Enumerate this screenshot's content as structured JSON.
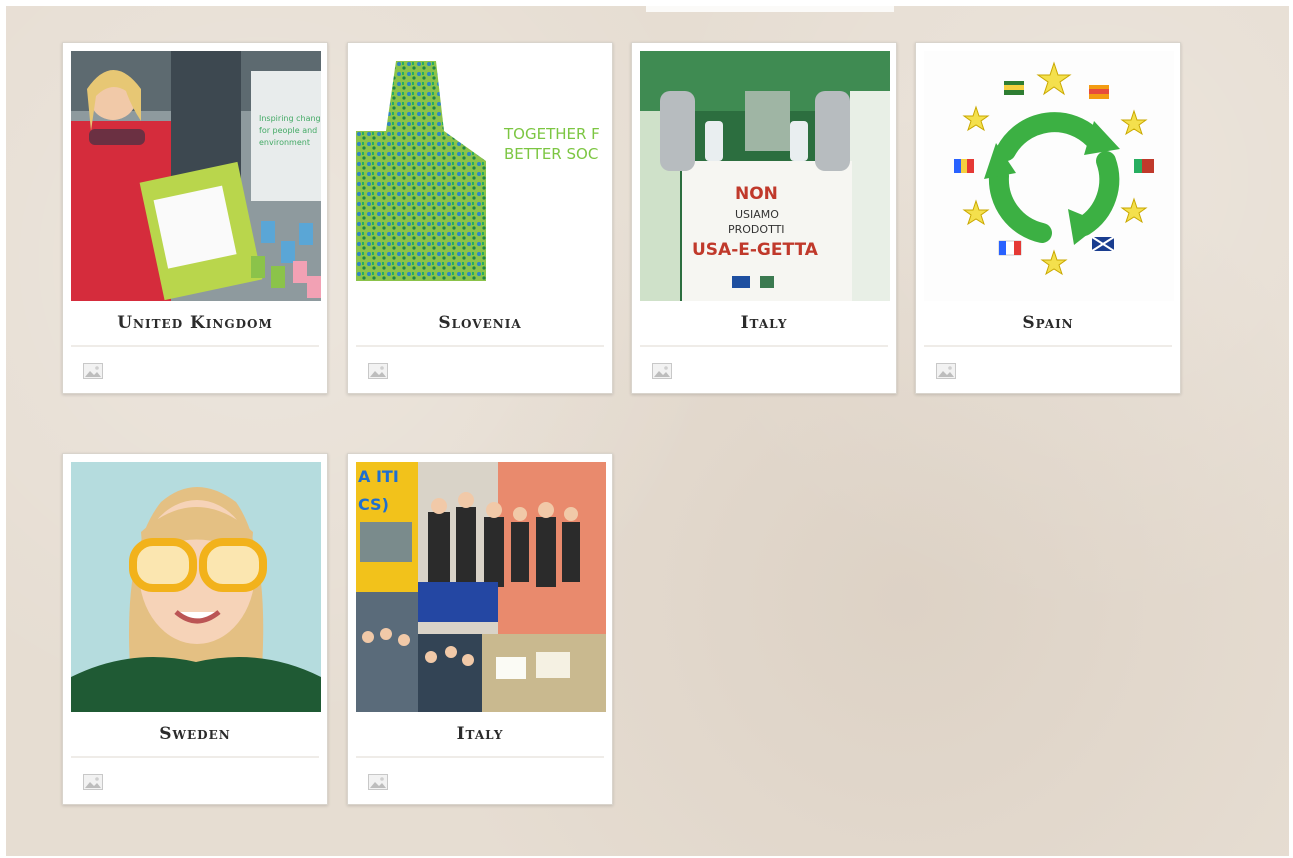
{
  "cards": [
    {
      "title": "United Kingdom",
      "image": "uk-person-with-reusable-box",
      "icon": "image-icon"
    },
    {
      "title": "Slovenia",
      "image": "thumbs-up-pattern",
      "icon": "image-icon",
      "image_text": [
        "TOGETHER F",
        "BETTER SOC"
      ]
    },
    {
      "title": "Italy",
      "image": "non-usiamo-prodotti-sign",
      "icon": "image-icon",
      "image_text": [
        "NON",
        "USIAMO",
        "PRODOTTI",
        "USA-E-GETTA"
      ]
    },
    {
      "title": "Spain",
      "image": "recycle-stars-flags",
      "icon": "image-icon"
    },
    {
      "title": "Sweden",
      "image": "girl-with-glasses",
      "icon": "image-icon"
    },
    {
      "title": "Italy",
      "image": "school-event-collage",
      "icon": "image-icon",
      "image_text": [
        "A ITI",
        "CS)"
      ]
    }
  ],
  "colors": {
    "background": "#e6ddd2",
    "card": "#ffffff",
    "title": "#2b2b2b",
    "divider": "#efece8",
    "recycle_green": "#3cb043",
    "slovenia_green": "#4caf50"
  }
}
